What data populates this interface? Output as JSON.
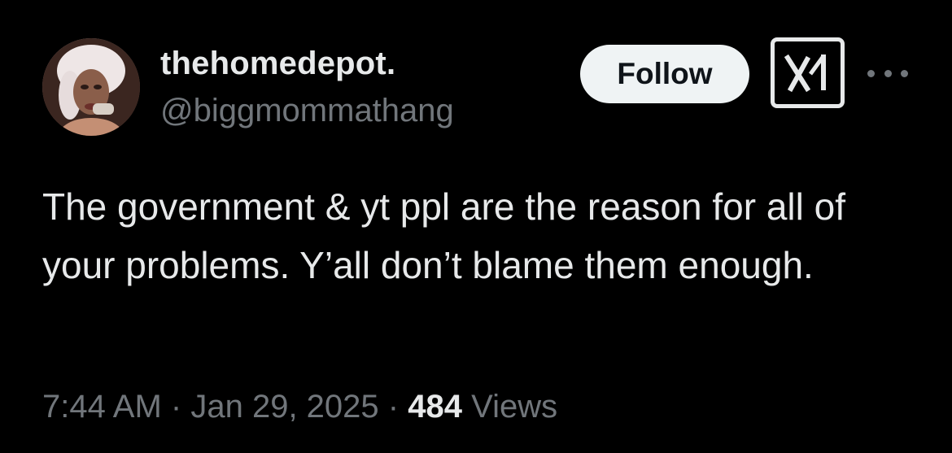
{
  "author": {
    "display_name": "thehomedepot.",
    "handle": "@biggmommathang",
    "avatar_icon": "profile-photo"
  },
  "actions": {
    "follow_label": "Follow",
    "grok_icon": "grok-icon",
    "more_icon": "more-horizontal-icon"
  },
  "tweet": {
    "text": "The government & yt ppl are the reason for all of your problems. Y’all don’t blame them enough."
  },
  "meta": {
    "time": "7:44 AM",
    "separator": "·",
    "date": "Jan 29, 2025",
    "views_count": "484",
    "views_label": "Views"
  },
  "colors": {
    "background": "#000000",
    "primary_text": "#e7e9ea",
    "secondary_text": "#71767b",
    "follow_bg": "#eff3f4",
    "follow_text": "#0f1419"
  }
}
